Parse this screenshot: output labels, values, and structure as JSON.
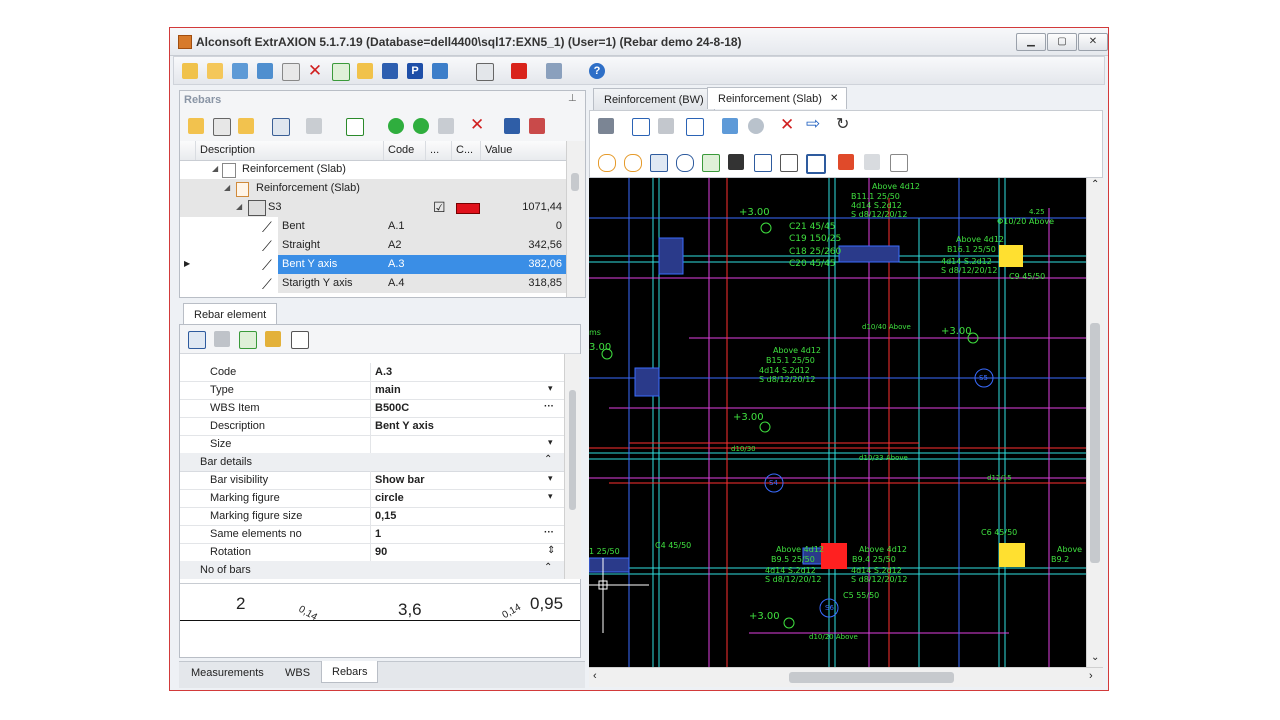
{
  "window": {
    "title": "Alconsoft ExtrAXION 5.1.7.19 (Database=dell4400\\sql17:EXN5_1) (User=1) (Rebar demo 24-8-18)",
    "min_btn": "▁",
    "max_btn": "▢",
    "close_btn": "✕"
  },
  "rebars_panel": {
    "title": "Rebars",
    "pin": "⊥",
    "columns": [
      "Description",
      "Code",
      "...",
      "C...",
      "Value"
    ],
    "rows": [
      {
        "description": "Reinforcement (Slab)",
        "code": "",
        "value": "",
        "level": 0
      },
      {
        "description": "Reinforcement (Slab)",
        "code": "",
        "value": "",
        "level": 1
      },
      {
        "description": "S3",
        "code": "",
        "value": "1071,44",
        "level": 2,
        "checked": true,
        "color": "#e0111b"
      },
      {
        "description": "Bent",
        "code": "A.1",
        "value": "0",
        "level": 3
      },
      {
        "description": "Straight",
        "code": "A2",
        "value": "342,56",
        "level": 3
      },
      {
        "description": "Bent Y axis",
        "code": "A.3",
        "value": "382,06",
        "level": 3,
        "selected": true
      },
      {
        "description": "Starigth Y axis",
        "code": "A.4",
        "value": "318,85",
        "level": 3
      }
    ]
  },
  "rebar_element": {
    "tab": "Rebar element",
    "props": [
      {
        "name": "Code",
        "value": "A.3",
        "editor": ""
      },
      {
        "name": "Type",
        "value": "main",
        "editor": "▾"
      },
      {
        "name": "WBS Item",
        "value": "B500C",
        "editor": "···"
      },
      {
        "name": "Description",
        "value": "Bent Y axis",
        "editor": ""
      },
      {
        "name": "Size",
        "value": "",
        "editor": "▾"
      }
    ],
    "category_bar": "Bar details",
    "bar_props": [
      {
        "name": "Bar visibility",
        "value": "Show bar",
        "editor": "▾"
      },
      {
        "name": "Marking figure",
        "value": "circle",
        "editor": "▾"
      },
      {
        "name": "Marking figure size",
        "value": "0,15",
        "editor": ""
      },
      {
        "name": "Same elements no",
        "value": "1",
        "editor": "···"
      },
      {
        "name": "Rotation",
        "value": "90",
        "editor": "⇕"
      }
    ],
    "category_no": "No of bars"
  },
  "bar_shape": {
    "seg1": "2",
    "angle1": "0,14",
    "seg2": "3,6",
    "angle2": "0,14",
    "seg3": "0,95"
  },
  "bottom_tabs": [
    "Measurements",
    "WBS",
    "Rebars"
  ],
  "doc_tabs": [
    {
      "label": "Reinforcement (BW)",
      "active": false
    },
    {
      "label": "Reinforcement (Slab)",
      "active": true
    }
  ],
  "doc_tab_close": "✕",
  "cad_labels": {
    "l1": "+3.00",
    "l2": "C21 45/45",
    "l3": "C19 150/25",
    "l4": "C18 25/260",
    "l5": "C20 45/45",
    "l6": "Above 4d12",
    "l7": "B11.1 25/50",
    "l8": "4d14 S.2d12",
    "l9": "S d8/12/20/12",
    "l10": "Above 4d12",
    "l11": "B16.1 25/50",
    "l12": "4d14 S.2d12",
    "l13": "S d8/12/20/12",
    "l14": "C9 45/50",
    "l15": "Φ10/20 Above",
    "l16": "+3.00",
    "l17": "d10/40 Above",
    "l18": "Above 4d12",
    "l19": "B15.1 25/50",
    "l20": "4d14 S.2d12",
    "l21": "S d8/12/20/12",
    "l22": "+3.00",
    "l23": "d10/30",
    "l24": "d10/33 Above",
    "l25": "d12/15",
    "l26": "C6 45/50",
    "l27": "C4 45/50",
    "l28": "Above 4d12",
    "l29": "B9.5 25/50",
    "l30": "4d14 S.2d12",
    "l31": "S d8/12/20/12",
    "l32": "Above 4d12",
    "l33": "B9.4 25/50",
    "l34": "4d14 S.2d12",
    "l35": "S d8/12/20/12",
    "l36": "C5 55/50",
    "l37": "+3.00",
    "l38": "d10/20 Above",
    "l39": "Above",
    "l40": "B9.2",
    "l41": "S4",
    "l42": "S5",
    "l43": "S6",
    "l44": "1 25/50",
    "l45": "3.00",
    "l46": "ms",
    "l47": "4.25"
  }
}
